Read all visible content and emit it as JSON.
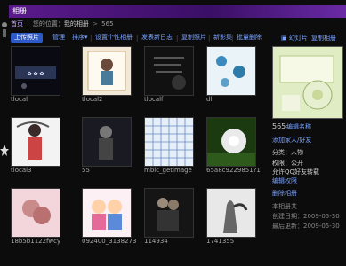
{
  "window": {
    "title": "相册"
  },
  "nav": {
    "home": "首页",
    "location_label": "您的位置：",
    "crumb": "我的相册",
    "current": "565"
  },
  "toolbar": {
    "upload": "上传照片",
    "items": [
      "管理",
      "排序▾",
      "设置个性相册",
      "发表新日志",
      "复制照片",
      "新影集",
      "批量删除"
    ]
  },
  "grid": [
    {
      "caption": "tlocal",
      "art": "dark-girl"
    },
    {
      "caption": "tlocal2",
      "art": "girl-card"
    },
    {
      "caption": "tlocalf",
      "art": "dark-text"
    },
    {
      "caption": "dl",
      "art": "blue-flowers"
    },
    {
      "caption": "tlocal3",
      "art": "girl-umbrella"
    },
    {
      "caption": "55",
      "art": "dark-figure"
    },
    {
      "caption": "mblc_getimage",
      "art": "blue-grid"
    },
    {
      "caption": "65a8c9229851?1",
      "art": "dandelion"
    },
    {
      "caption": "18b5b1122fwcy",
      "art": "pink-love"
    },
    {
      "caption": "092400_3138273",
      "art": "couple-cartoon"
    },
    {
      "caption": "114934",
      "art": "couple-dark"
    },
    {
      "caption": "1741355",
      "art": "hand-bw"
    }
  ],
  "side": {
    "top_links": [
      "幻灯片",
      "复制相册"
    ],
    "album_name": "565",
    "edit_link": "编辑名称",
    "invite_link": "添加家人/好友",
    "share_link": "邀请好友评论",
    "category": "分类：人物",
    "permission": "权限：公开",
    "reprint": "允许QQ好友转载",
    "reprint_set": "编辑权限",
    "delete_album": "删除相册",
    "stats_label": "本相册共",
    "created": "创建日期：2009-05-30",
    "updated": "最后更新：2009-05-30"
  },
  "colors": {
    "accent": "#2d59c9",
    "link": "#7aa3ff",
    "title_purple": "#5a1a8c"
  }
}
